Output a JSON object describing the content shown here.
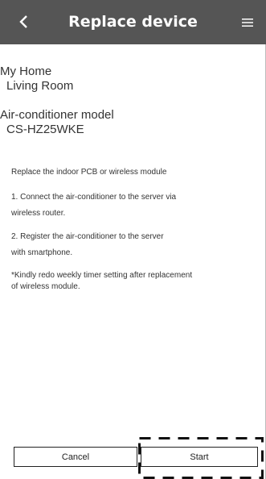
{
  "header": {
    "back_icon": "chevron-left-icon",
    "title": "Replace device",
    "menu_icon": "hamburger-menu-icon",
    "background": "#555555"
  },
  "location": {
    "home": "My Home",
    "room": "Living Room"
  },
  "model": {
    "label": "Air-conditioner model",
    "value": "CS-HZ25WKE"
  },
  "instructions": {
    "heading": "Replace the indoor PCB or wireless module",
    "step1_line1": "1. Connect the air-conditioner to the server via",
    "step1_line2": "wireless router.",
    "step2_line1": "2. Register the air-conditioner to the server",
    "step2_line2": "with smartphone.",
    "note_line1": "*Kindly redo weekly timer setting after replacement",
    "note_line2": "of wireless module."
  },
  "buttons": {
    "cancel_label": "Cancel",
    "start_label": "Start"
  }
}
